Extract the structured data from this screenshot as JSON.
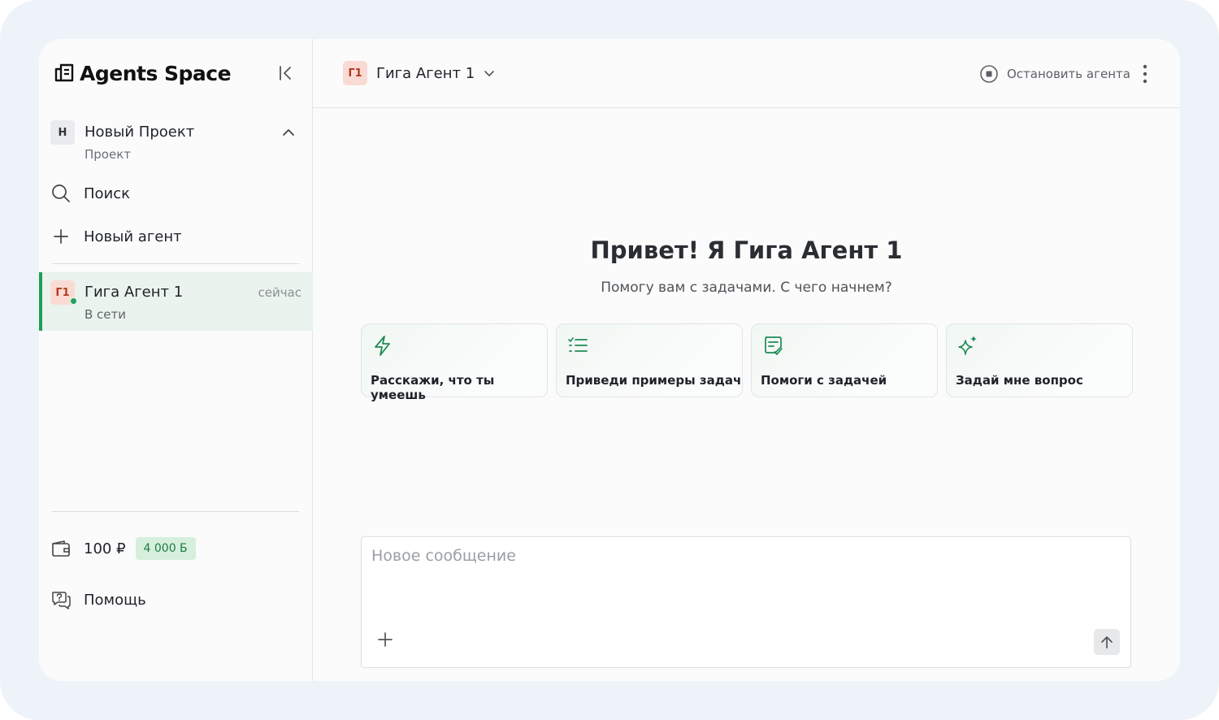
{
  "app": {
    "title": "Agents Space"
  },
  "sidebar": {
    "project": {
      "badge": "Н",
      "name": "Новый Проект",
      "subtitle": "Проект"
    },
    "search_label": "Поиск",
    "new_agent_label": "Новый агент",
    "agents": [
      {
        "badge": "Г1",
        "name": "Гига Агент 1",
        "status": "В сети",
        "time": "сейчас",
        "selected": true
      }
    ],
    "balance": "100 ₽",
    "tokens": "4 000 Б",
    "help_label": "Помощь"
  },
  "header": {
    "agent_badge": "Г1",
    "agent_name": "Гига Агент 1",
    "stop_label": "Остановить агента"
  },
  "welcome": {
    "title": "Привет! Я Гига Агент 1",
    "subtitle": "Помогу вам с задачами. С чего начнем?"
  },
  "suggestions": [
    {
      "icon": "lightning-icon",
      "label": "Расскажи, что ты умеешь"
    },
    {
      "icon": "checklist-icon",
      "label": "Приведи примеры задач"
    },
    {
      "icon": "task-note-icon",
      "label": "Помоги с задачей"
    },
    {
      "icon": "sparkles-icon",
      "label": "Задай мне вопрос"
    }
  ],
  "composer": {
    "placeholder": "Новое сообщение",
    "value": ""
  },
  "colors": {
    "accent": "#1f9d5b",
    "selected_bg": "#eaf3ed",
    "avatar_bg": "#fadbd3",
    "tokens_bg": "#d6efdc"
  }
}
